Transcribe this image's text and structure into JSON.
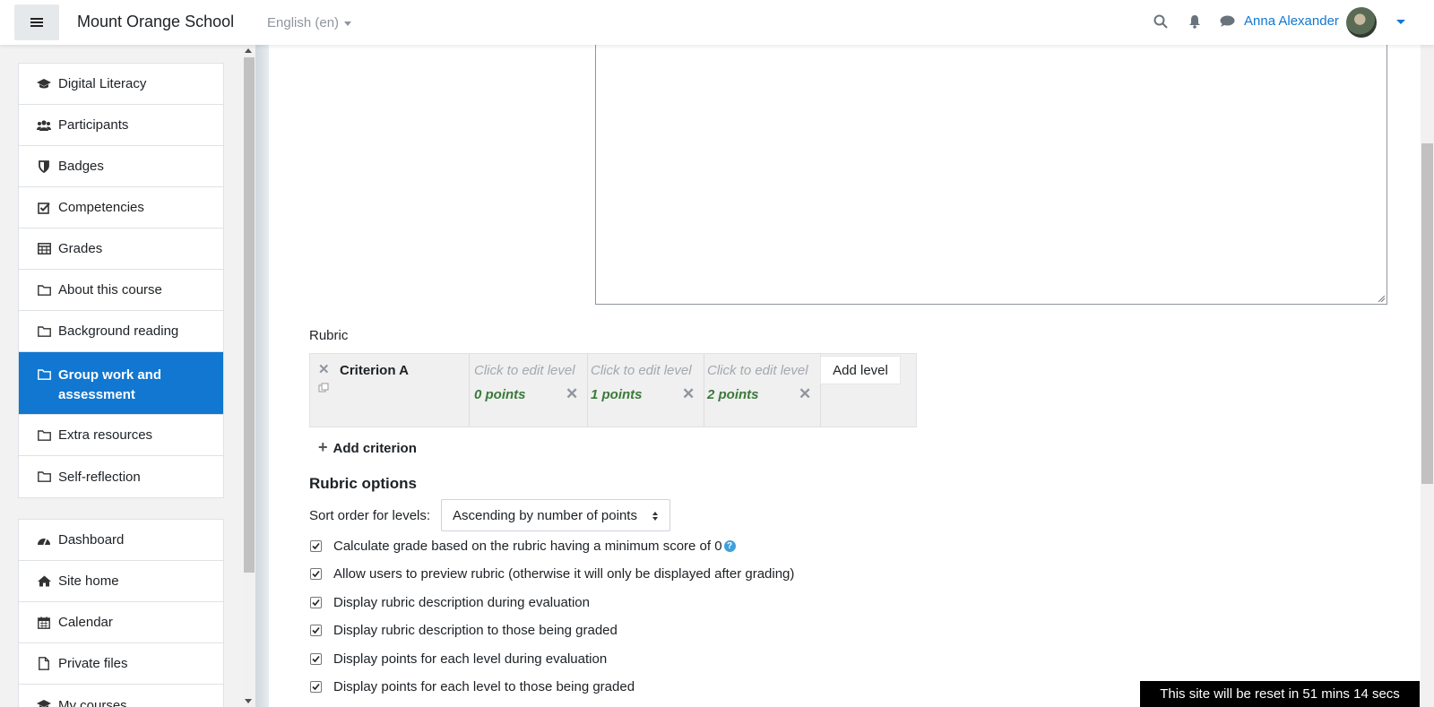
{
  "navbar": {
    "site_name": "Mount Orange School",
    "language": "English (en)",
    "user_name": "Anna Alexander"
  },
  "drawer": {
    "course_items": [
      {
        "label": "Digital Literacy",
        "icon": "graduation-cap-icon"
      },
      {
        "label": "Participants",
        "icon": "users-icon"
      },
      {
        "label": "Badges",
        "icon": "shield-icon"
      },
      {
        "label": "Competencies",
        "icon": "checkbox-icon"
      },
      {
        "label": "Grades",
        "icon": "table-icon"
      },
      {
        "label": "About this course",
        "icon": "folder-icon"
      },
      {
        "label": "Background reading",
        "icon": "folder-icon"
      },
      {
        "label": "Group work and assessment",
        "icon": "folder-icon",
        "active": true
      },
      {
        "label": "Extra resources",
        "icon": "folder-icon"
      },
      {
        "label": "Self-reflection",
        "icon": "folder-icon"
      }
    ],
    "site_items": [
      {
        "label": "Dashboard",
        "icon": "dashboard-icon"
      },
      {
        "label": "Site home",
        "icon": "home-icon"
      },
      {
        "label": "Calendar",
        "icon": "calendar-icon"
      },
      {
        "label": "Private files",
        "icon": "file-icon"
      },
      {
        "label": "My courses",
        "icon": "graduation-cap-icon"
      }
    ]
  },
  "rubric": {
    "section_label": "Rubric",
    "criterion_name": "Criterion A",
    "levels": [
      {
        "description": "Click to edit level",
        "points": "0 points"
      },
      {
        "description": "Click to edit level",
        "points": "1 points"
      },
      {
        "description": "Click to edit level",
        "points": "2 points"
      }
    ],
    "add_level_label": "Add level",
    "add_criterion_label": "Add criterion"
  },
  "options": {
    "title": "Rubric options",
    "sort_label": "Sort order for levels:",
    "sort_value": "Ascending by number of points",
    "checkboxes": [
      "Calculate grade based on the rubric having a minimum score of 0",
      "Allow users to preview rubric (otherwise it will only be displayed after grading)",
      "Display rubric description during evaluation",
      "Display rubric description to those being graded",
      "Display points for each level during evaluation",
      "Display points for each level to those being graded"
    ]
  },
  "banner": {
    "reset_text": "This site will be reset in 51 mins 14 secs"
  }
}
